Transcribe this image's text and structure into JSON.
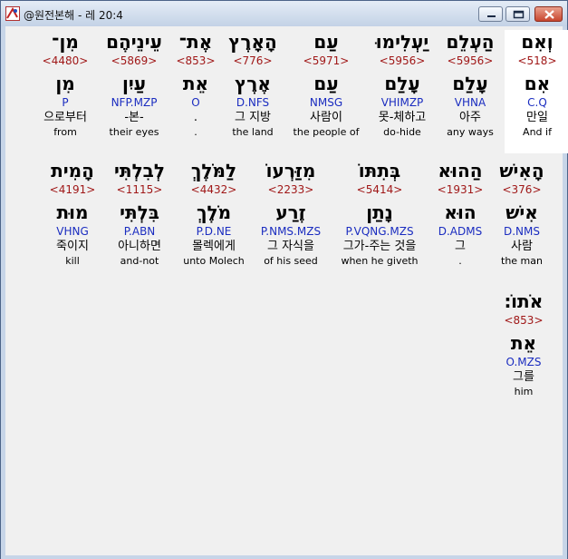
{
  "window": {
    "title": "@원전본해 - 레 20:4"
  },
  "rows": [
    [
      {
        "heb": "וְאִם",
        "strong": "<518>",
        "lex": "אִם",
        "parse": "C.Q",
        "ko": "만일",
        "en": "And if",
        "highlight": true
      },
      {
        "heb": "הַעְלֵם",
        "strong": "<5956>",
        "lex": "עָלַם",
        "parse": "VHNA",
        "ko": "아주",
        "en": "any ways"
      },
      {
        "heb": "יַעְלִימוּ",
        "strong": "<5956>",
        "lex": "עָלַם",
        "parse": "VHIMZP",
        "ko": "못-체하고",
        "en": "do-hide"
      },
      {
        "heb": "עַם",
        "strong": "<5971>",
        "lex": "עַם",
        "parse": "NMSG",
        "ko": "사람이",
        "en": "the people of"
      },
      {
        "heb": "הָאָרֶץ",
        "strong": "<776>",
        "lex": "אֶרֶץ",
        "parse": "D.NFS",
        "ko": "그 지방",
        "en": "the land"
      },
      {
        "heb": "אֶת־",
        "strong": "<853>",
        "lex": "אֵת",
        "parse": "O",
        "ko": ".",
        "en": "."
      },
      {
        "heb": "עֵינֵיהֶם",
        "strong": "<5869>",
        "lex": "עַיִן",
        "parse": "NFP.MZP",
        "ko": "-본-",
        "en": "their eyes"
      },
      {
        "heb": "מִן־",
        "strong": "<4480>",
        "lex": "מִן",
        "parse": "P",
        "ko": "으로부터",
        "en": "from"
      }
    ],
    [
      {
        "heb": "הָאִישׁ",
        "strong": "<376>",
        "lex": "אִישׁ",
        "parse": "D.NMS",
        "ko": "사람",
        "en": "the man"
      },
      {
        "heb": "הַהוּא",
        "strong": "<1931>",
        "lex": "הוּא",
        "parse": "D.ADMS",
        "ko": "그",
        "en": "."
      },
      {
        "heb": "בְּתִתּוֹ",
        "strong": "<5414>",
        "lex": "נָתַן",
        "parse": "P.VQNG.MZS",
        "ko": "그가-주는 것을",
        "en": "when he giveth"
      },
      {
        "heb": "מִזַּרְעוֹ",
        "strong": "<2233>",
        "lex": "זֶרַע",
        "parse": "P.NMS.MZS",
        "ko": "그 자식을",
        "en": "of his seed"
      },
      {
        "heb": "לַמֹּלֶךְ",
        "strong": "<4432>",
        "lex": "מֹלֶךְ",
        "parse": "P.D.NE",
        "ko": "몰렉에게",
        "en": "unto Molech"
      },
      {
        "heb": "לְבִלְתִּי",
        "strong": "<1115>",
        "lex": "בִּלְתִּי",
        "parse": "P.ABN",
        "ko": "아니하면",
        "en": "and-not"
      },
      {
        "heb": "הָמִית",
        "strong": "<4191>",
        "lex": "מוּת",
        "parse": "VHNG",
        "ko": "죽이지",
        "en": "kill"
      }
    ],
    [
      {
        "heb": "אֹתוֹ׃",
        "strong": "<853>",
        "lex": "אֵת",
        "parse": "O.MZS",
        "ko": "그를",
        "en": "him"
      }
    ]
  ]
}
